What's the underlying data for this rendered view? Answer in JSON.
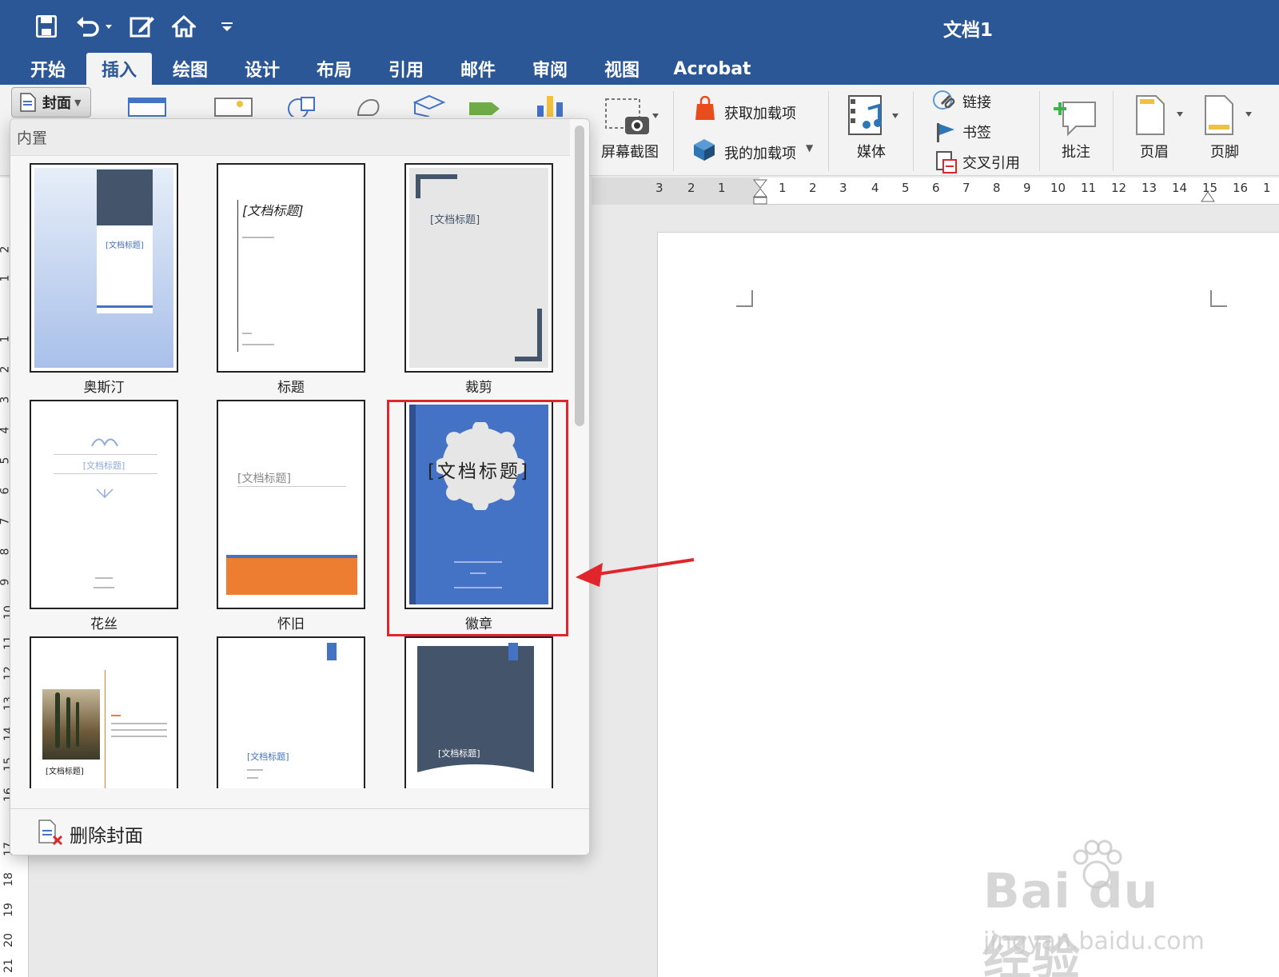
{
  "app": {
    "doc_title": "文档1"
  },
  "tabs": [
    {
      "label": "开始"
    },
    {
      "label": "插入"
    },
    {
      "label": "绘图"
    },
    {
      "label": "设计"
    },
    {
      "label": "布局"
    },
    {
      "label": "引用"
    },
    {
      "label": "邮件"
    },
    {
      "label": "审阅"
    },
    {
      "label": "视图"
    },
    {
      "label": "Acrobat"
    }
  ],
  "ribbon": {
    "cover_label": "封面",
    "screenshot_label": "屏幕截图",
    "get_addins_label": "获取加载项",
    "my_addins_label": "我的加载项",
    "media_label": "媒体",
    "link_label": "链接",
    "bookmark_label": "书签",
    "crossref_label": "交叉引用",
    "comment_label": "批注",
    "header_label": "页眉",
    "footer_label": "页脚"
  },
  "ruler": {
    "h_numbers": [
      "3",
      "2",
      "1",
      "1",
      "2",
      "3",
      "4",
      "5",
      "6",
      "7",
      "8",
      "9",
      "10",
      "11",
      "12",
      "13",
      "14",
      "15",
      "16",
      "1"
    ],
    "v_numbers": [
      "2",
      "1",
      "1",
      "2",
      "3",
      "4",
      "5",
      "6",
      "7",
      "8",
      "9",
      "10",
      "11",
      "12",
      "13",
      "14",
      "15",
      "16",
      "17",
      "18",
      "19",
      "20",
      "21"
    ]
  },
  "gallery": {
    "section_title": "内置",
    "remove_cover_label": "删除封面",
    "items": [
      {
        "label": "奥斯汀",
        "title": "[文档标题]"
      },
      {
        "label": "标题",
        "title": "[文档标题]"
      },
      {
        "label": "裁剪",
        "title": "[文档标题]"
      },
      {
        "label": "花丝",
        "title": "[文档标题]"
      },
      {
        "label": "怀旧",
        "title": "[文档标题]"
      },
      {
        "label": "徽章",
        "title": "[文档标题]"
      },
      {
        "label": "",
        "title": "[文档标题]"
      },
      {
        "label": "",
        "title": "[文档标题]"
      },
      {
        "label": "",
        "title": "[文档标题]"
      }
    ]
  },
  "watermark": {
    "brand": "Bai du 经验",
    "url": "jingyan.baidu.com"
  },
  "colors": {
    "title_bar": "#2b5797",
    "highlight": "#e0262b",
    "badge_blue": "#4472c4",
    "orange": "#ed7d31"
  }
}
